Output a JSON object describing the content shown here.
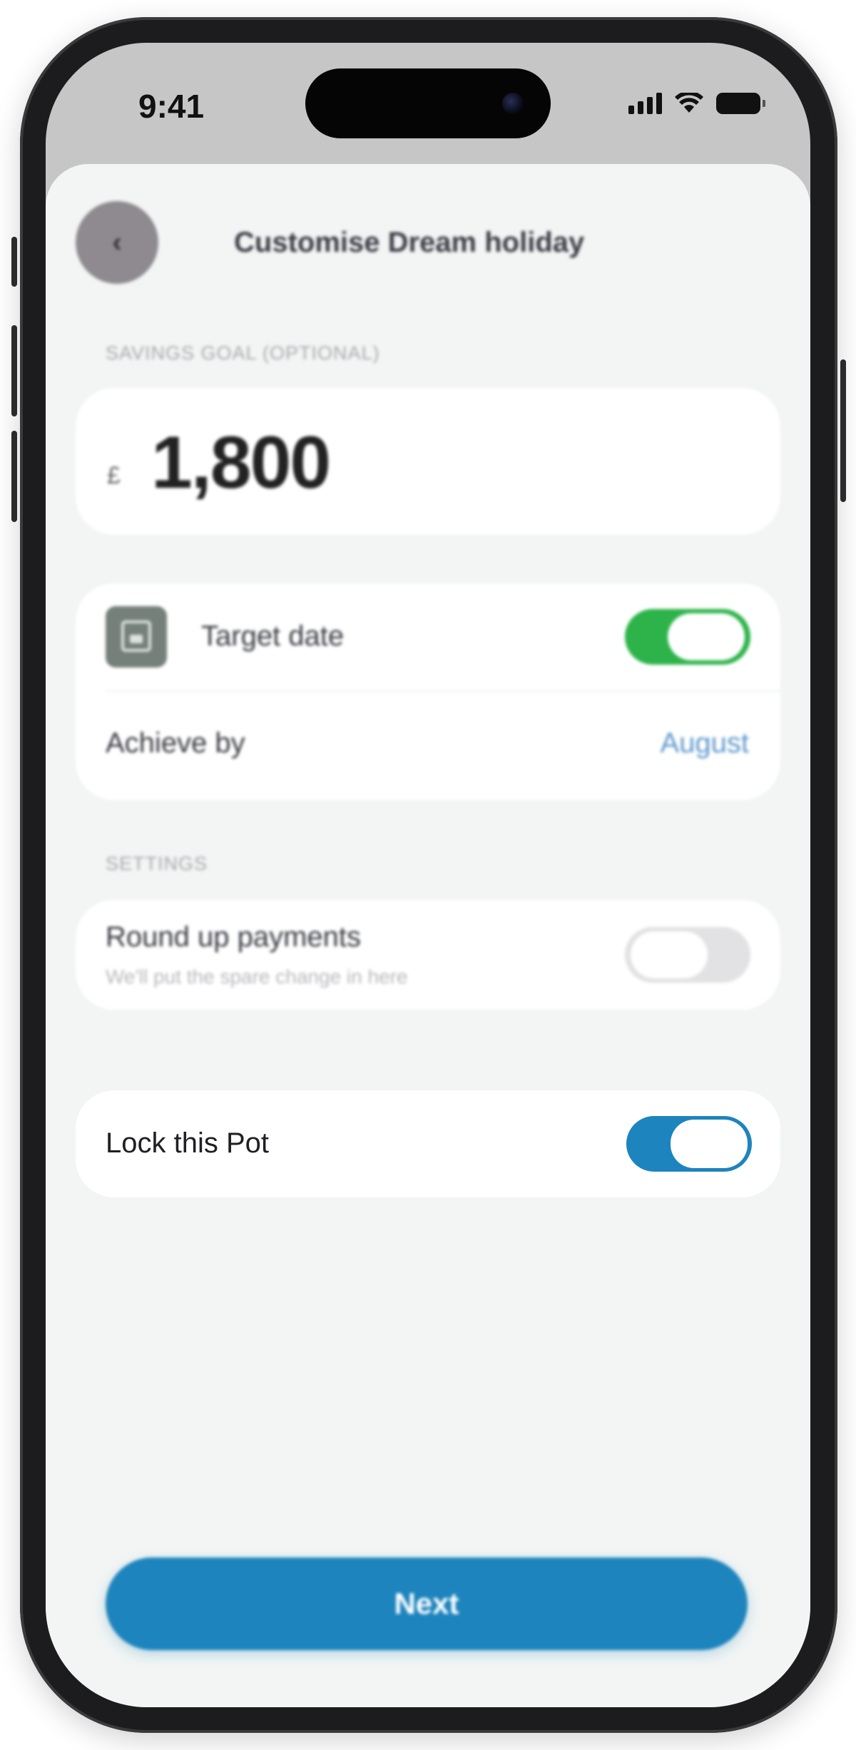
{
  "status_bar": {
    "time": "9:41",
    "icons": [
      "cellular-signal-icon",
      "wifi-icon",
      "battery-icon"
    ]
  },
  "header": {
    "back_icon": "chevron-left-icon",
    "title": "Customise Dream holiday"
  },
  "savings_goal": {
    "section_label": "SAVINGS GOAL (OPTIONAL)",
    "currency_symbol": "£",
    "amount": "1,800"
  },
  "target_date": {
    "icon": "calendar-icon",
    "label": "Target date",
    "toggle_on": true,
    "achieve_by_label": "Achieve by",
    "achieve_by_value": "August"
  },
  "settings": {
    "section_label": "SETTINGS",
    "round_up": {
      "label": "Round up payments",
      "description": "We'll put the spare change in here",
      "toggle_on": false
    },
    "lock_pot": {
      "label": "Lock this Pot",
      "toggle_on": true
    }
  },
  "footer": {
    "next_label": "Next"
  },
  "colors": {
    "brand_blue": "#1d84bd",
    "toggle_green": "#2db34a",
    "toggle_off": "#e2e1e3",
    "link_blue": "#5d98cc",
    "sheet_bg": "#f2f5f4"
  }
}
